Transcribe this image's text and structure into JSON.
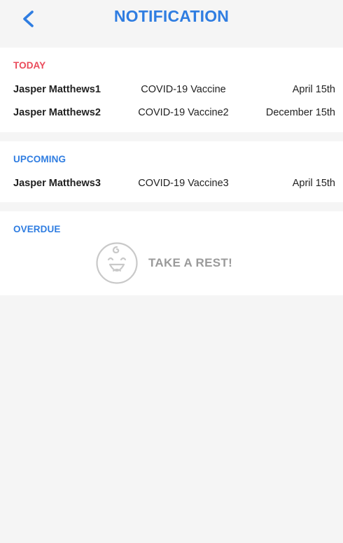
{
  "header": {
    "title": "NOTIFICATION"
  },
  "sections": {
    "today": {
      "label": "TODAY",
      "rows": [
        {
          "name": "Jasper Matthews1",
          "vaccine": "COVID-19 Vaccine",
          "date": "April 15th"
        },
        {
          "name": "Jasper Matthews2",
          "vaccine": "COVID-19 Vaccine2",
          "date": "December 15th"
        }
      ]
    },
    "upcoming": {
      "label": "UPCOMING",
      "rows": [
        {
          "name": "Jasper Matthews3",
          "vaccine": "COVID-19 Vaccine3",
          "date": "April 15th"
        }
      ]
    },
    "overdue": {
      "label": "OVERDUE",
      "empty_text": "TAKE A REST!"
    }
  },
  "colors": {
    "accent": "#2f7de1",
    "today": "#ea4a5a",
    "muted": "#9a9a9a"
  }
}
